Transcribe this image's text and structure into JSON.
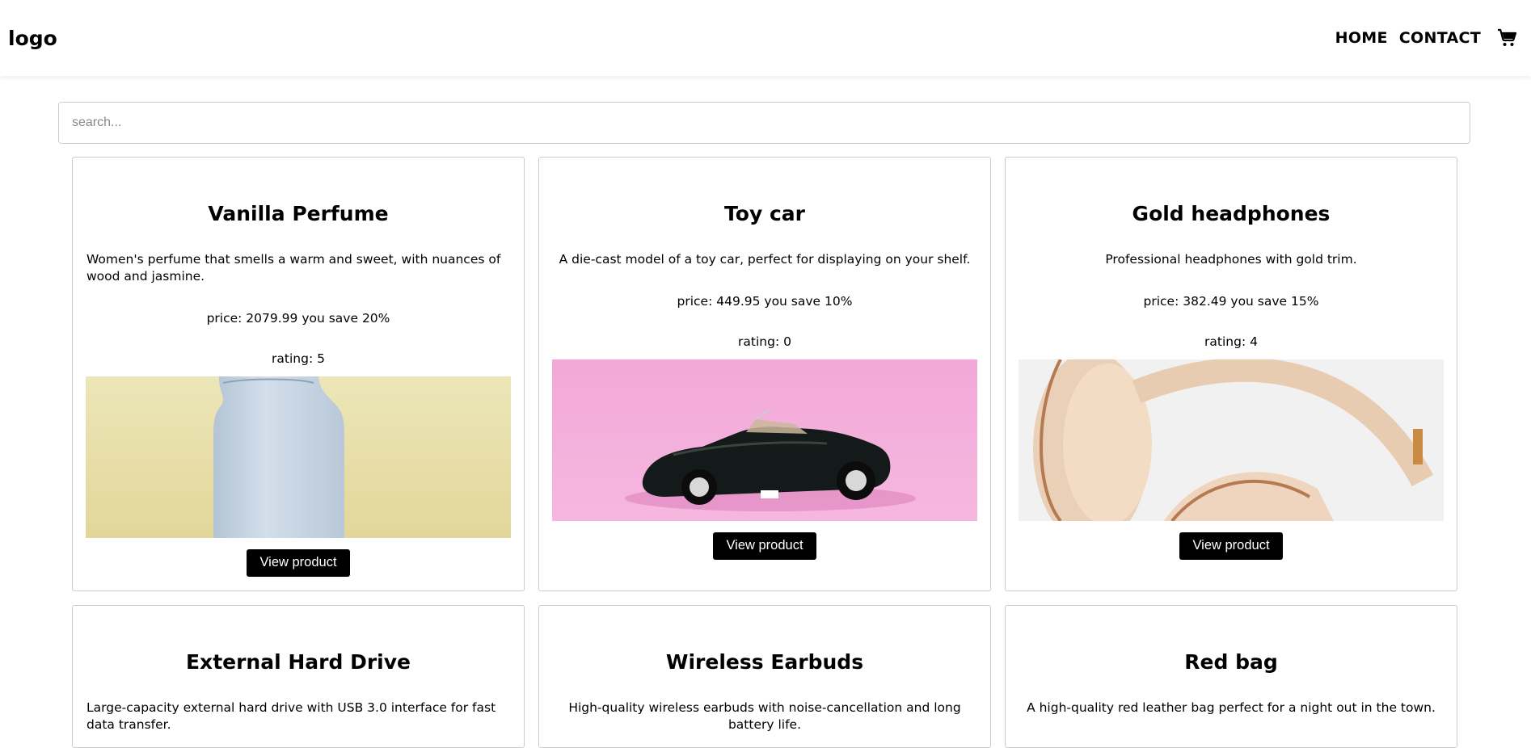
{
  "header": {
    "logo": "logo",
    "nav": {
      "home": "HOME",
      "contact": "CONTACT"
    },
    "cart_icon": "shopping-cart-icon"
  },
  "search": {
    "placeholder": "search..."
  },
  "button_label": "View product",
  "products": [
    {
      "title": "Vanilla Perfume",
      "description": "Women's perfume that smells a warm and sweet, with nuances of wood and jasmine.",
      "price": "price: 2079.99 you save 20%",
      "rating": "rating: 5",
      "image": "perfume-bottle"
    },
    {
      "title": "Toy car",
      "description": "A die-cast model of a toy car, perfect for displaying on your shelf.",
      "price": "price: 449.95 you save 10%",
      "rating": "rating: 0",
      "image": "toy-car"
    },
    {
      "title": "Gold headphones",
      "description": "Professional headphones with gold trim.",
      "price": "price: 382.49 you save 15%",
      "rating": "rating: 4",
      "image": "headphones"
    },
    {
      "title": "External Hard Drive",
      "description": "Large-capacity external hard drive with USB 3.0 interface for fast data transfer."
    },
    {
      "title": "Wireless Earbuds",
      "description": "High-quality wireless earbuds with noise-cancellation and long battery life."
    },
    {
      "title": "Red bag",
      "description": "A high-quality red leather bag perfect for a night out in the town."
    }
  ],
  "colors": {
    "accent": "#000000",
    "border": "#cccccc"
  }
}
